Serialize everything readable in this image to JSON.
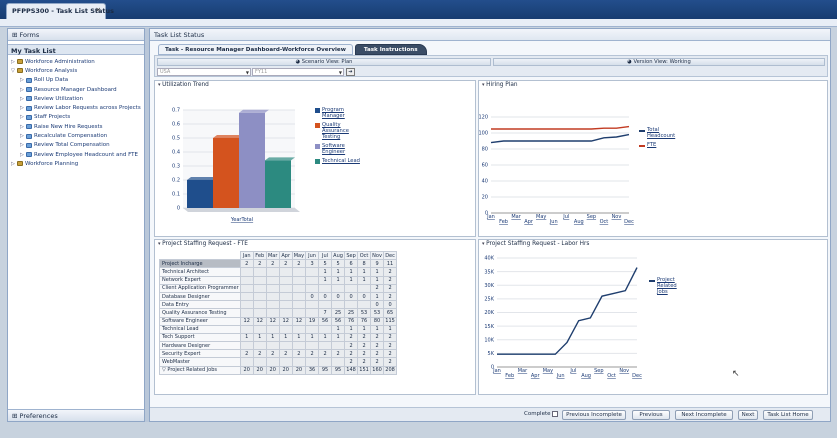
{
  "window": {
    "tab_title": "PFPPS300 - Task List Status",
    "close": "✕"
  },
  "left": {
    "forms": "Forms",
    "my_task_list": "My Task List",
    "tree": [
      {
        "label": "Workforce Administration",
        "level": 0,
        "twisty": "▷",
        "kind": "folder"
      },
      {
        "label": "Workforce Analysis",
        "level": 0,
        "twisty": "▽",
        "kind": "folder"
      },
      {
        "label": "Roll Up Data",
        "level": 1,
        "twisty": "▷",
        "kind": "task"
      },
      {
        "label": "Resource Manager Dashboard",
        "level": 1,
        "twisty": "▷",
        "kind": "task"
      },
      {
        "label": "Review Utilization",
        "level": 1,
        "twisty": "▷",
        "kind": "task"
      },
      {
        "label": "Review Labor Requests across Projects",
        "level": 1,
        "twisty": "▷",
        "kind": "task"
      },
      {
        "label": "Staff Projects",
        "level": 1,
        "twisty": "▷",
        "kind": "task"
      },
      {
        "label": "Raise New Hire Requests",
        "level": 1,
        "twisty": "▷",
        "kind": "task"
      },
      {
        "label": "Recalculate Compensation",
        "level": 1,
        "twisty": "▷",
        "kind": "task"
      },
      {
        "label": "Review Total Compensation",
        "level": 1,
        "twisty": "▷",
        "kind": "task"
      },
      {
        "label": "Review Employee Headcount and FTE",
        "level": 1,
        "twisty": "▷",
        "kind": "task"
      },
      {
        "label": "Workforce Planning",
        "level": 0,
        "twisty": "▷",
        "kind": "folder"
      }
    ],
    "preferences": "Preferences"
  },
  "main": {
    "header": "Task List Status",
    "tabs": [
      "Task - Resource Manager Dashboard-Workforce Overview",
      "Task Instructions"
    ],
    "scenario_view": "Scenario View: Plan",
    "version_view": "Version View: Working",
    "pov1": "USA",
    "pov2": "FY11",
    "go": "➔"
  },
  "panels": {
    "utilization": "Utilization Trend",
    "hiring": "Hiring Plan",
    "staffing": "Project Staffing Request - FTE",
    "labor": "Project Staffing Request - Labor Hrs"
  },
  "chart_data": [
    {
      "type": "bar",
      "categories": [
        "YearTotal"
      ],
      "series": [
        {
          "name": "Program Manager",
          "values": [
            0.2
          ],
          "color": "#1f4e8c"
        },
        {
          "name": "Quality Assurance Testing",
          "values": [
            0.5
          ],
          "color": "#d4531e"
        },
        {
          "name": "Software Engineer",
          "values": [
            0.68
          ],
          "color": "#8d8fc4"
        },
        {
          "name": "Technical Lead",
          "values": [
            0.34
          ],
          "color": "#2c8a80"
        }
      ],
      "yticks": [
        "0",
        "0.1",
        "0.2",
        "0.3",
        "0.4",
        "0.5",
        "0.6",
        "0.7"
      ],
      "ylim": [
        0,
        0.7
      ]
    },
    {
      "type": "line",
      "x": [
        "Jan",
        "Feb",
        "Mar",
        "Apr",
        "May",
        "Jun",
        "Jul",
        "Aug",
        "Sep",
        "Oct",
        "Nov",
        "Dec"
      ],
      "series": [
        {
          "name": "Total Headcount",
          "values": [
            88,
            90,
            90,
            90,
            90,
            90,
            90,
            90,
            90,
            94,
            95,
            98
          ],
          "color": "#1f3e6e"
        },
        {
          "name": "FTE",
          "values": [
            105,
            105,
            105,
            105,
            105,
            105,
            105,
            105,
            105,
            106,
            106,
            108
          ],
          "color": "#c23b22"
        }
      ],
      "yticks": [
        "0",
        "20",
        "40",
        "60",
        "80",
        "100",
        "120"
      ],
      "ylim": [
        0,
        120
      ]
    },
    {
      "type": "line",
      "x": [
        "Jan",
        "Feb",
        "Mar",
        "Apr",
        "May",
        "Jun",
        "Jul",
        "Aug",
        "Sep",
        "Oct",
        "Nov",
        "Dec"
      ],
      "series": [
        {
          "name": "Project Related Jobs",
          "values": [
            4700,
            4700,
            4700,
            4700,
            4700,
            4700,
            9000,
            17000,
            18000,
            26000,
            27000,
            28000,
            36500
          ],
          "color": "#1f3e6e"
        }
      ],
      "yticks": [
        "0",
        "5K",
        "10K",
        "15K",
        "20K",
        "25K",
        "30K",
        "35K",
        "40K"
      ],
      "ylim": [
        0,
        40000
      ]
    }
  ],
  "staffing_table": {
    "months": [
      "Jan",
      "Feb",
      "Mar",
      "Apr",
      "May",
      "Jun",
      "Jul",
      "Aug",
      "Sep",
      "Oct",
      "Nov",
      "Dec"
    ],
    "rows": [
      {
        "label": "Project Incharge",
        "values": [
          "2",
          "2",
          "2",
          "2",
          "2",
          "3",
          "5",
          "5",
          "6",
          "8",
          "9",
          "11"
        ]
      },
      {
        "label": "Technical Architect",
        "values": [
          "",
          "",
          "",
          "",
          "",
          "",
          "1",
          "1",
          "1",
          "1",
          "1",
          "2"
        ]
      },
      {
        "label": "Network Expert",
        "values": [
          "",
          "",
          "",
          "",
          "",
          "",
          "1",
          "1",
          "1",
          "1",
          "1",
          "2"
        ]
      },
      {
        "label": "Client Application Programmer",
        "values": [
          "",
          "",
          "",
          "",
          "",
          "",
          "",
          "",
          "",
          "",
          "2",
          "2"
        ]
      },
      {
        "label": "Database Designer",
        "values": [
          "",
          "",
          "",
          "",
          "",
          "0",
          "0",
          "0",
          "0",
          "0",
          "1",
          "2"
        ]
      },
      {
        "label": "Data Entry",
        "values": [
          "",
          "",
          "",
          "",
          "",
          "",
          "",
          "",
          "",
          "",
          "0",
          "0"
        ]
      },
      {
        "label": "Quality Assurance Testing",
        "values": [
          "",
          "",
          "",
          "",
          "",
          "",
          "7",
          "25",
          "25",
          "53",
          "53",
          "65"
        ]
      },
      {
        "label": "Software Engineer",
        "values": [
          "12",
          "12",
          "12",
          "12",
          "12",
          "19",
          "56",
          "56",
          "76",
          "76",
          "80",
          "115"
        ]
      },
      {
        "label": "Technical Lead",
        "values": [
          "",
          "",
          "",
          "",
          "",
          "",
          "",
          "1",
          "1",
          "1",
          "1",
          "1"
        ]
      },
      {
        "label": "Tech Support",
        "values": [
          "1",
          "1",
          "1",
          "1",
          "1",
          "1",
          "1",
          "1",
          "2",
          "2",
          "2",
          "2"
        ]
      },
      {
        "label": "Hardware Designer",
        "values": [
          "",
          "",
          "",
          "",
          "",
          "",
          "",
          "",
          "2",
          "2",
          "2",
          "2"
        ]
      },
      {
        "label": "Security Expert",
        "values": [
          "2",
          "2",
          "2",
          "2",
          "2",
          "2",
          "2",
          "2",
          "2",
          "2",
          "2",
          "2"
        ]
      },
      {
        "label": "WebMaster",
        "values": [
          "",
          "",
          "",
          "",
          "",
          "",
          "",
          "",
          "2",
          "2",
          "2",
          "2"
        ]
      },
      {
        "label": "▽ Project Related Jobs",
        "values": [
          "20",
          "20",
          "20",
          "20",
          "20",
          "36",
          "95",
          "95",
          "148",
          "151",
          "160",
          "208"
        ]
      }
    ]
  },
  "footer": {
    "complete": "Complete",
    "buttons": [
      "Previous Incomplete",
      "Previous",
      "Next Incomplete",
      "Next",
      "Task List Home"
    ]
  }
}
